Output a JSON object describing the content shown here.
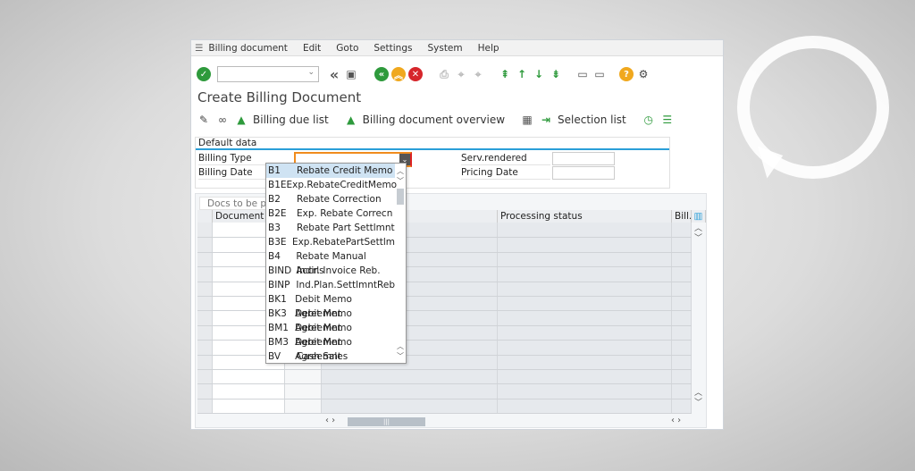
{
  "menu": {
    "items": [
      "Billing document",
      "Edit",
      "Goto",
      "Settings",
      "System",
      "Help"
    ]
  },
  "toolbar": {
    "command_field": "",
    "icons": [
      "enter-check",
      "command-field",
      "back-double",
      "save",
      "back",
      "exit",
      "cancel",
      "print",
      "find",
      "find-next",
      "first-page",
      "previous-page",
      "next-page",
      "last-page",
      "create-session",
      "shortcut",
      "help",
      "customize-layout"
    ]
  },
  "title": "Create Billing Document",
  "app_toolbar": {
    "billing_due_list": "Billing due list",
    "billing_document_overview": "Billing document overview",
    "selection_list": "Selection list"
  },
  "default_data": {
    "header": "Default data",
    "billing_type_label": "Billing Type",
    "billing_type_value": "",
    "billing_date_label": "Billing Date",
    "serv_rendered_label": "Serv.rendered",
    "pricing_date_label": "Pricing Date"
  },
  "table": {
    "tab": "Docs to be pro",
    "columns": [
      "Document",
      "",
      "",
      "Processing status",
      "Bill..."
    ]
  },
  "dropdown": {
    "items": [
      {
        "code": "B1",
        "text": "Rebate Credit Memo"
      },
      {
        "code": "B1E",
        "text": "Exp.RebateCreditMemo"
      },
      {
        "code": "B2",
        "text": "Rebate Correction"
      },
      {
        "code": "B2E",
        "text": "Exp. Rebate Correcn"
      },
      {
        "code": "B3",
        "text": "Rebate Part Settlmnt"
      },
      {
        "code": "B3E",
        "text": "Exp.RebatePartSettlm"
      },
      {
        "code": "B4",
        "text": "Rebate Manual Accrls"
      },
      {
        "code": "BIND",
        "text": "Indir. Invoice Reb."
      },
      {
        "code": "BINP",
        "text": "Ind.Plan.SettlmntReb"
      },
      {
        "code": "BK1",
        "text": "Debit Memo Agreemnt"
      },
      {
        "code": "BK3",
        "text": "Debit Memo Agreemnt"
      },
      {
        "code": "BM1",
        "text": "Debit Memo Agreemnt"
      },
      {
        "code": "BM3",
        "text": "Debit Memo Agreemnt"
      },
      {
        "code": "BV",
        "text": "Cash Sales"
      }
    ],
    "selected": "B1"
  },
  "colors": {
    "accent": "#2a9fd8",
    "focus": "#f08c1e",
    "ok": "#2e9a3c",
    "warn": "#f0a81e",
    "cancel": "#d6262b"
  }
}
